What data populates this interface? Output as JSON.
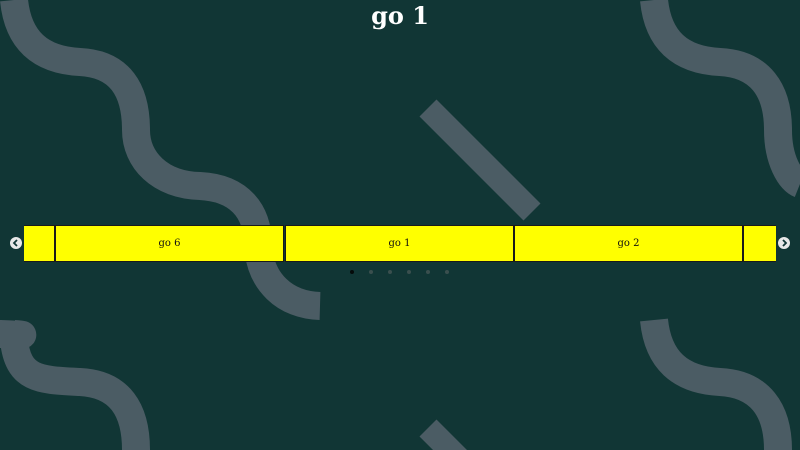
{
  "page": {
    "title": "go 1",
    "background_color": "#113635",
    "decoration_color": "#4b5c64",
    "slide_color": "#ffff00"
  },
  "carousel": {
    "prev_icon": "chevron-left-icon",
    "next_icon": "chevron-right-icon",
    "slides": [
      {
        "label": ""
      },
      {
        "label": "go 6"
      },
      {
        "label": "go 1"
      },
      {
        "label": "go 2"
      },
      {
        "label": ""
      }
    ],
    "dots_count": 6,
    "active_dot": 0
  }
}
